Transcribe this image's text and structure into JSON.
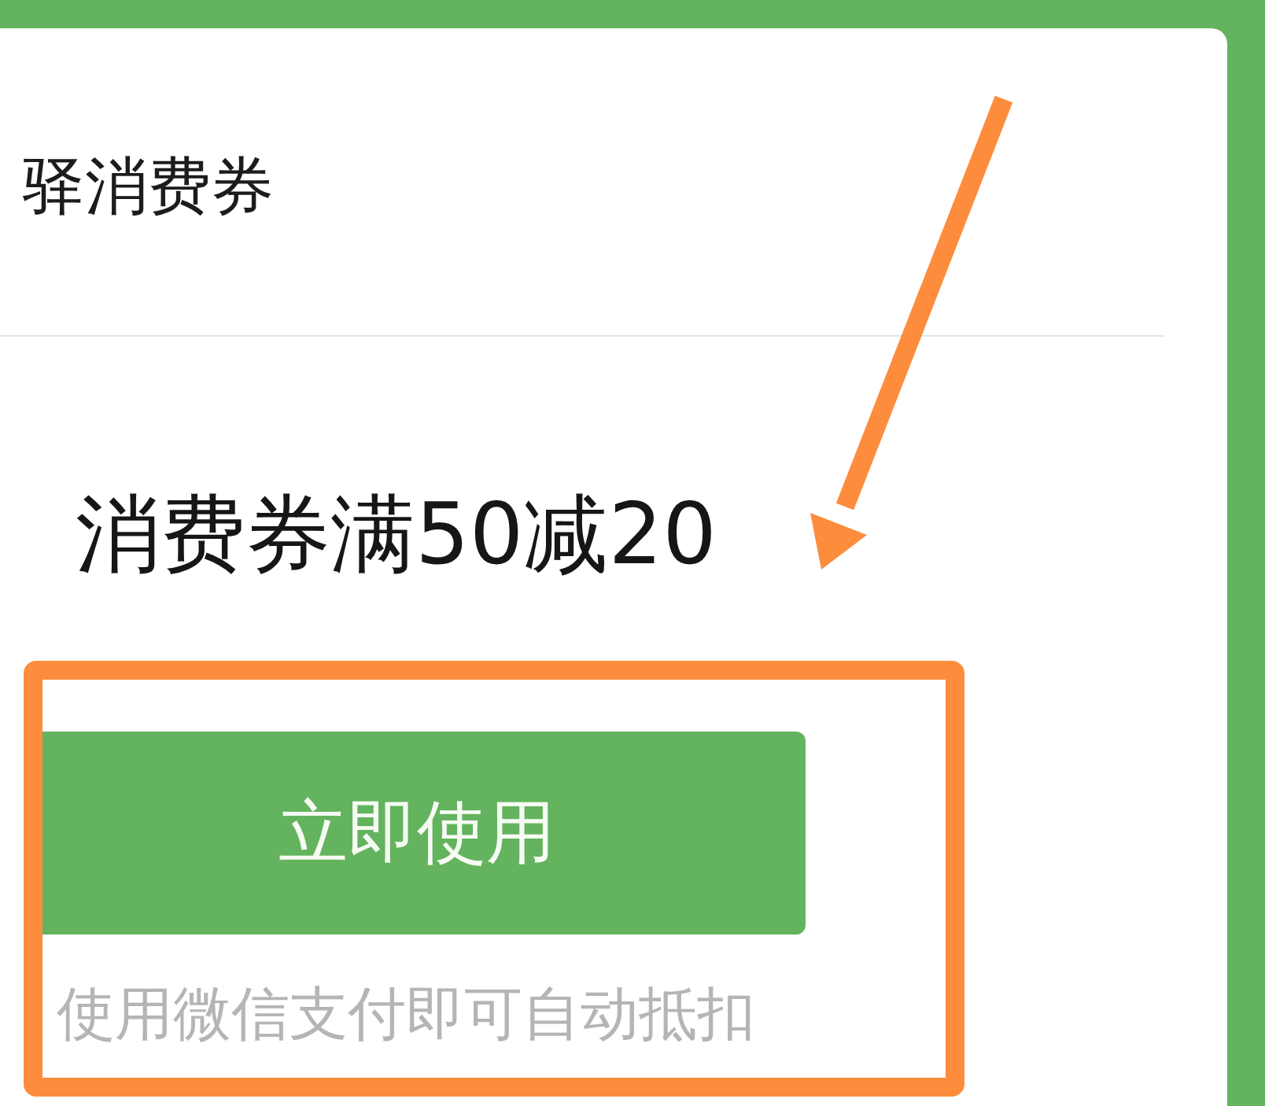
{
  "card": {
    "title": "驿消费券"
  },
  "coupon": {
    "offer": "消费券满50减20",
    "button": "立即使用",
    "hint": "使用微信支付即可自动抵扣"
  }
}
